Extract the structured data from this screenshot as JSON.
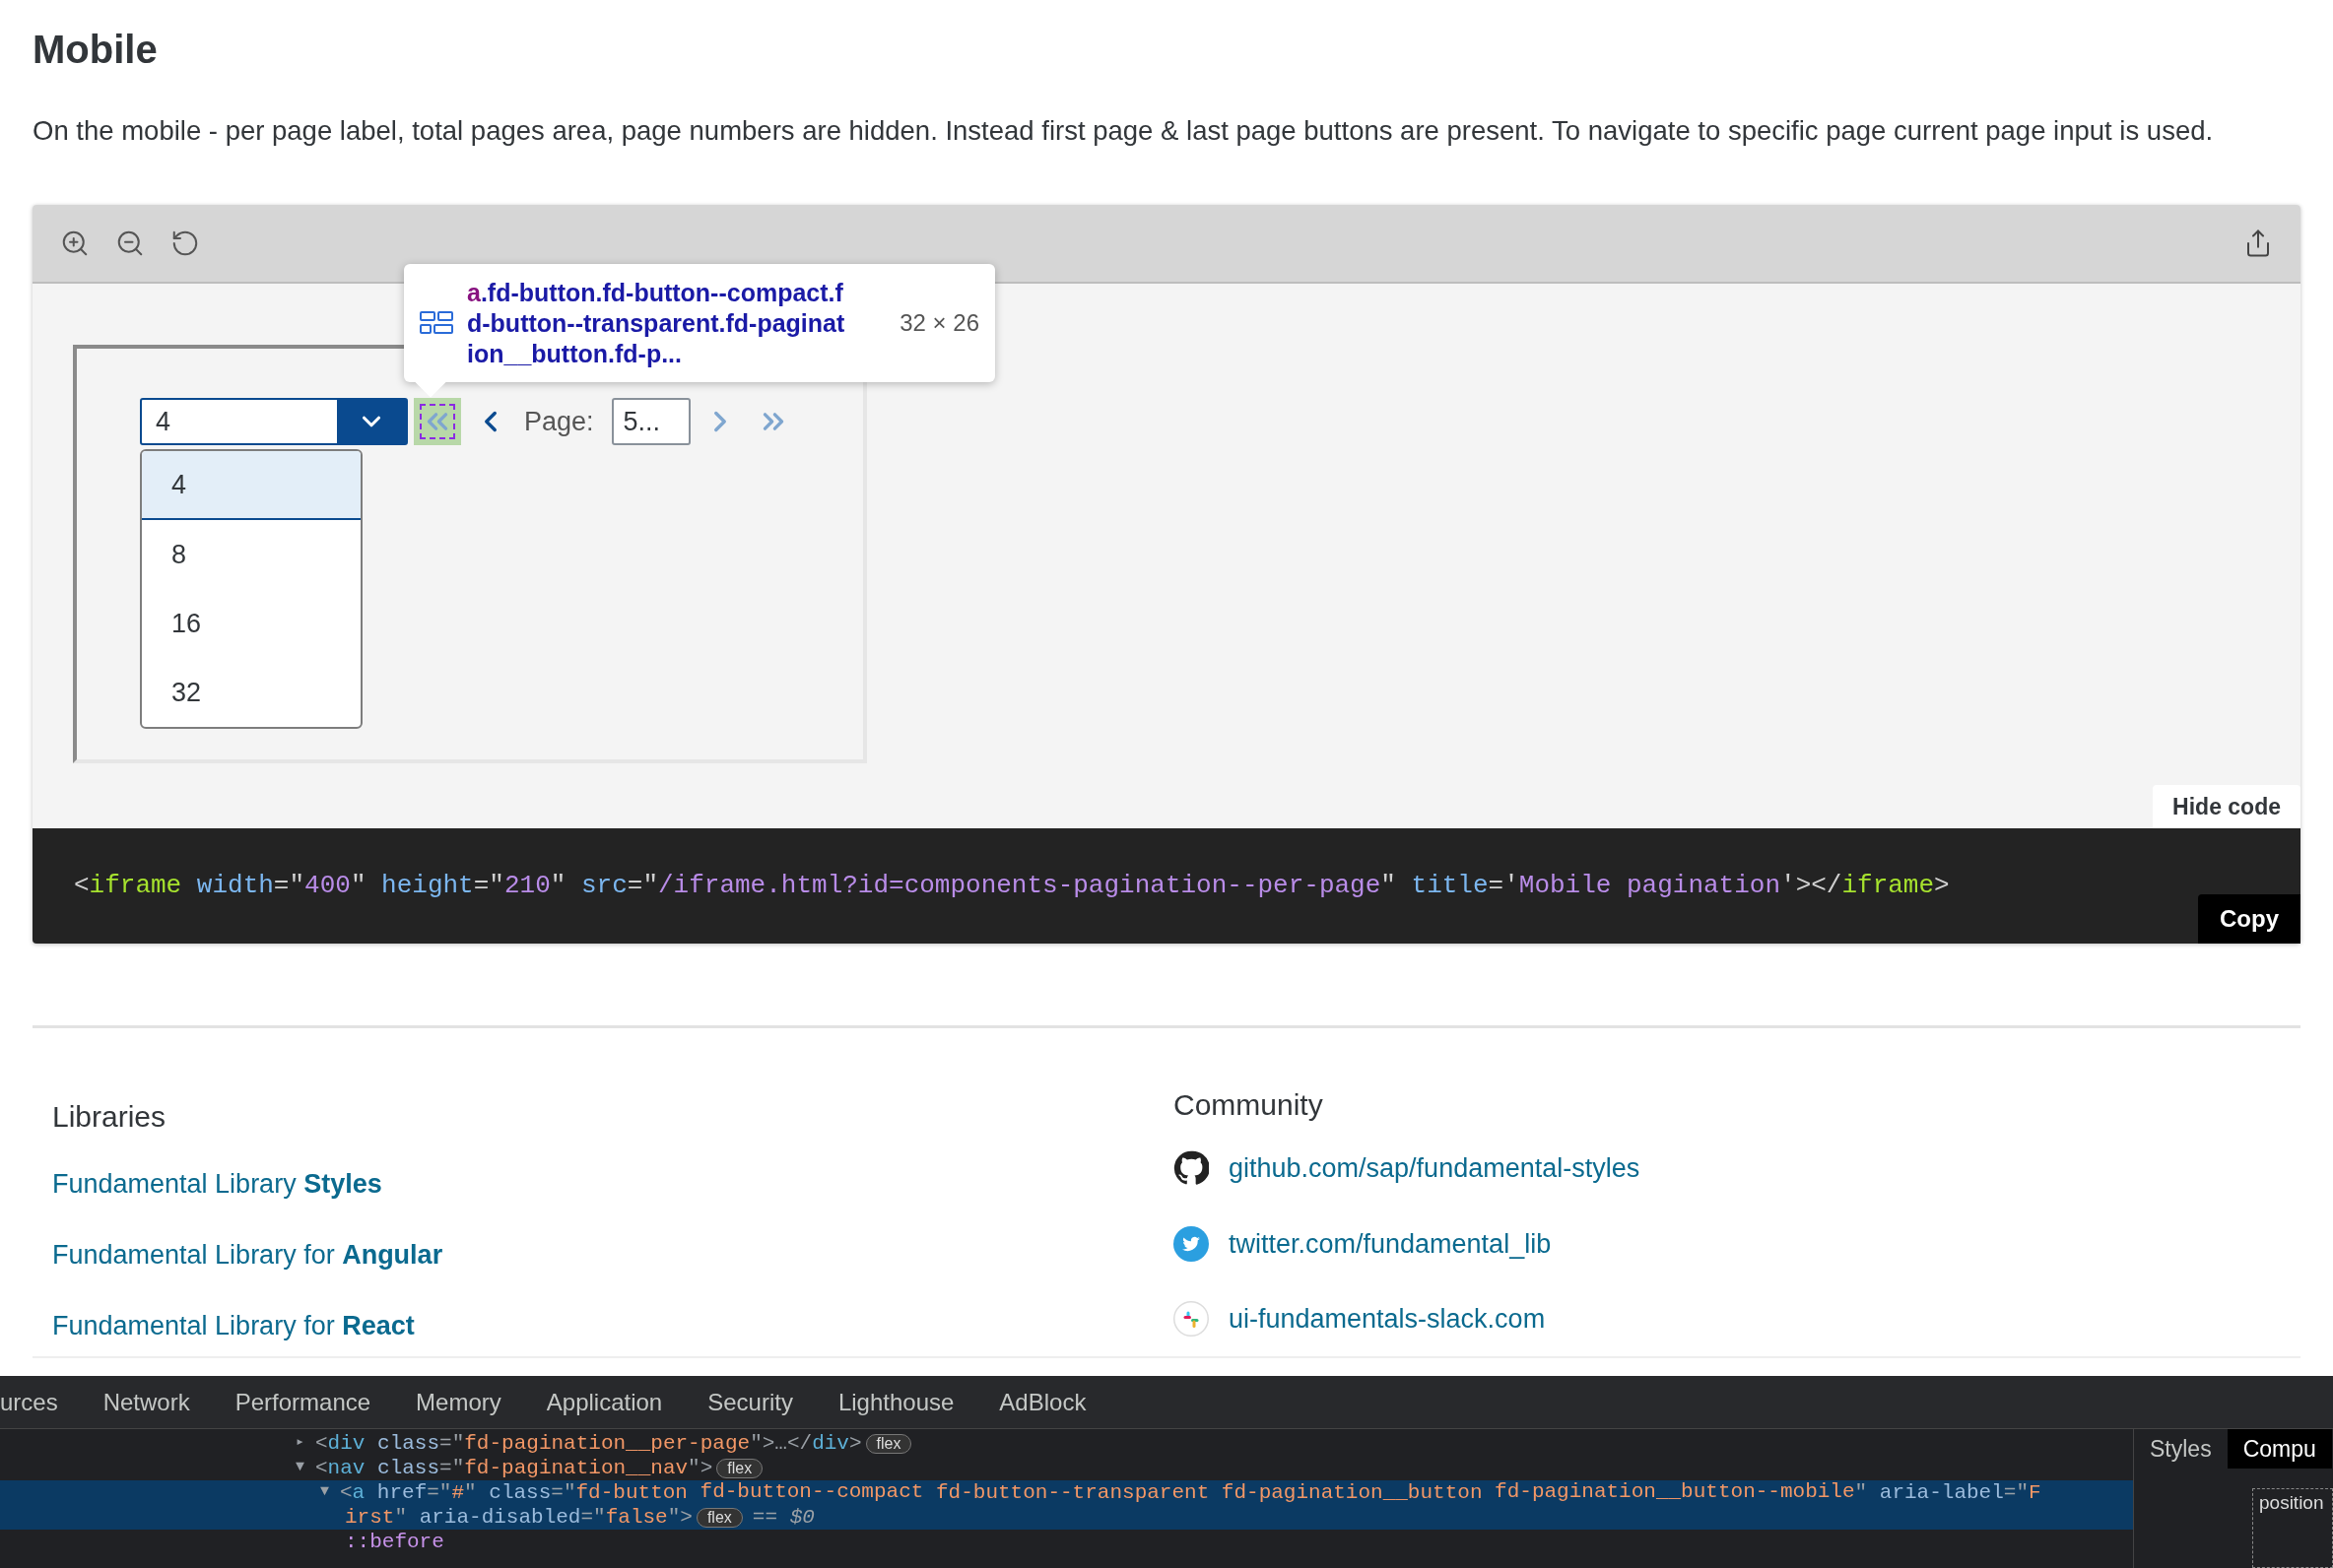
{
  "heading": "Mobile",
  "description": "On the mobile - per page label, total pages area, page numbers are hidden. Instead first page & last page buttons are present. To navigate to specific page current page input is used.",
  "preview": {
    "toolbar": [
      {
        "kind": "zoom-in"
      },
      {
        "kind": "zoom-out"
      },
      {
        "kind": "reset"
      }
    ],
    "per_page": {
      "value": "4",
      "expanded": true,
      "options": [
        {
          "label": "4",
          "selected": true
        },
        {
          "label": "8",
          "selected": false
        },
        {
          "label": "16",
          "selected": false
        },
        {
          "label": "32",
          "selected": false
        }
      ]
    },
    "nav": [
      {
        "kind": "first",
        "disabled": true,
        "inspected": true
      },
      {
        "kind": "prev",
        "disabled": false,
        "inspected": false
      }
    ],
    "page_label": "Page:",
    "page_input": "5...",
    "nav_after": [
      {
        "kind": "next",
        "disabled": true,
        "inspected": false
      },
      {
        "kind": "last",
        "disabled": true,
        "inspected": false
      }
    ],
    "inspector_tooltip": {
      "element": "a",
      "selector_lines": [
        ".fd-button.fd-button--compact.f",
        "d-button--transparent.fd-paginat",
        "ion__button.fd-p..."
      ],
      "size": "32 × 26"
    },
    "hide_code": "Hide code",
    "code": [
      {
        "text": "<",
        "kind": "punct"
      },
      {
        "text": "iframe",
        "kind": "tag"
      },
      {
        "text": " width",
        "kind": "attr"
      },
      {
        "text": "=\"",
        "kind": "punct"
      },
      {
        "text": "400",
        "kind": "value"
      },
      {
        "text": "\"",
        "kind": "punct"
      },
      {
        "text": " height",
        "kind": "attr"
      },
      {
        "text": "=\"",
        "kind": "punct"
      },
      {
        "text": "210",
        "kind": "value"
      },
      {
        "text": "\"",
        "kind": "punct"
      },
      {
        "text": " src",
        "kind": "attr"
      },
      {
        "text": "=\"",
        "kind": "punct"
      },
      {
        "text": "/iframe.html?id=components-pagination--per-page",
        "kind": "value"
      },
      {
        "text": "\"",
        "kind": "punct"
      },
      {
        "text": " title",
        "kind": "attr"
      },
      {
        "text": "='",
        "kind": "punct"
      },
      {
        "text": "Mobile pagination",
        "kind": "value"
      },
      {
        "text": "'></",
        "kind": "punct"
      },
      {
        "text": "iframe",
        "kind": "tag"
      },
      {
        "text": ">",
        "kind": "punct"
      }
    ],
    "copy": "Copy"
  },
  "footer": {
    "libraries": {
      "title": "Libraries",
      "links": [
        "Fundamental Library **Styles**",
        "Fundamental Library for **Angular**",
        "Fundamental Library for **React**"
      ]
    },
    "community": {
      "title": "Community",
      "links": [
        {
          "kind": "github",
          "label": "github.com/sap/fundamental-styles"
        },
        {
          "kind": "twitter",
          "label": "twitter.com/fundamental_lib"
        },
        {
          "kind": "slack",
          "label": "ui-fundamentals-slack.com"
        }
      ]
    }
  },
  "devtools": {
    "tabs": [
      {
        "label": "urces",
        "selected": false
      },
      {
        "label": "Network",
        "selected": false
      },
      {
        "label": "Performance",
        "selected": false
      },
      {
        "label": "Memory",
        "selected": false
      },
      {
        "label": "Application",
        "selected": false
      },
      {
        "label": "Security",
        "selected": false
      },
      {
        "label": "Lighthouse",
        "selected": false
      },
      {
        "label": "AdBlock",
        "selected": false
      }
    ],
    "lines": [
      {
        "selected": false,
        "arrow": "▸",
        "segments": [
          {
            "text": "<",
            "kind": "punct"
          },
          {
            "text": "div",
            "kind": "tag"
          },
          {
            "text": " class",
            "kind": "attr"
          },
          {
            "text": "=\"",
            "kind": "punct"
          },
          {
            "text": "fd-pagination__per-page",
            "kind": "value"
          },
          {
            "text": "\">…</",
            "kind": "punct"
          },
          {
            "text": "div",
            "kind": "tag"
          },
          {
            "text": ">",
            "kind": "punct"
          },
          {
            "text": "flex",
            "kind": "badge"
          }
        ]
      },
      {
        "selected": false,
        "arrow": "▼",
        "segments": [
          {
            "text": "<",
            "kind": "punct"
          },
          {
            "text": "nav",
            "kind": "tag"
          },
          {
            "text": " class",
            "kind": "attr"
          },
          {
            "text": "=\"",
            "kind": "punct"
          },
          {
            "text": "fd-pagination__nav",
            "kind": "value"
          },
          {
            "text": "\">",
            "kind": "punct"
          },
          {
            "text": "flex",
            "kind": "badge"
          }
        ]
      },
      {
        "selected": true,
        "arrow": "▼",
        "segments": [
          {
            "text": "<",
            "kind": "punct"
          },
          {
            "text": "a",
            "kind": "tag"
          },
          {
            "text": " href",
            "kind": "attr"
          },
          {
            "text": "=\"",
            "kind": "punct"
          },
          {
            "text": "#",
            "kind": "value"
          },
          {
            "text": "\" ",
            "kind": "punct"
          },
          {
            "text": "class",
            "kind": "attr"
          },
          {
            "text": "=\"",
            "kind": "punct"
          },
          {
            "text": "fd-button ",
            "kind": "value"
          },
          {
            "text": "fd-button--compact",
            "kind": "value-marked"
          },
          {
            "text": " fd-button--transparent fd-pagination__button ",
            "kind": "value"
          },
          {
            "text": "fd-pagination__button--mobile",
            "kind": "value-marked"
          },
          {
            "text": "\" ",
            "kind": "punct"
          },
          {
            "text": "aria-label",
            "kind": "attr"
          },
          {
            "text": "=\"",
            "kind": "punct"
          },
          {
            "text": "F",
            "kind": "value"
          }
        ]
      },
      {
        "selected": true,
        "segments": [
          {
            "text": "irst",
            "kind": "value"
          },
          {
            "text": "\" ",
            "kind": "punct"
          },
          {
            "text": "aria-disabled",
            "kind": "attr"
          },
          {
            "text": "=\"",
            "kind": "punct"
          },
          {
            "text": "false",
            "kind": "value"
          },
          {
            "text": "\">",
            "kind": "punct"
          },
          {
            "text": "flex",
            "kind": "badge"
          },
          {
            "text": "== $0",
            "kind": "comment"
          }
        ]
      },
      {
        "selected": false,
        "segments": [
          {
            "text": "::before",
            "kind": "pseudo"
          }
        ]
      }
    ],
    "side_tabs": [
      {
        "label": "Styles",
        "selected": false
      },
      {
        "label": "Compu",
        "selected": true
      }
    ],
    "box_label": "position"
  }
}
